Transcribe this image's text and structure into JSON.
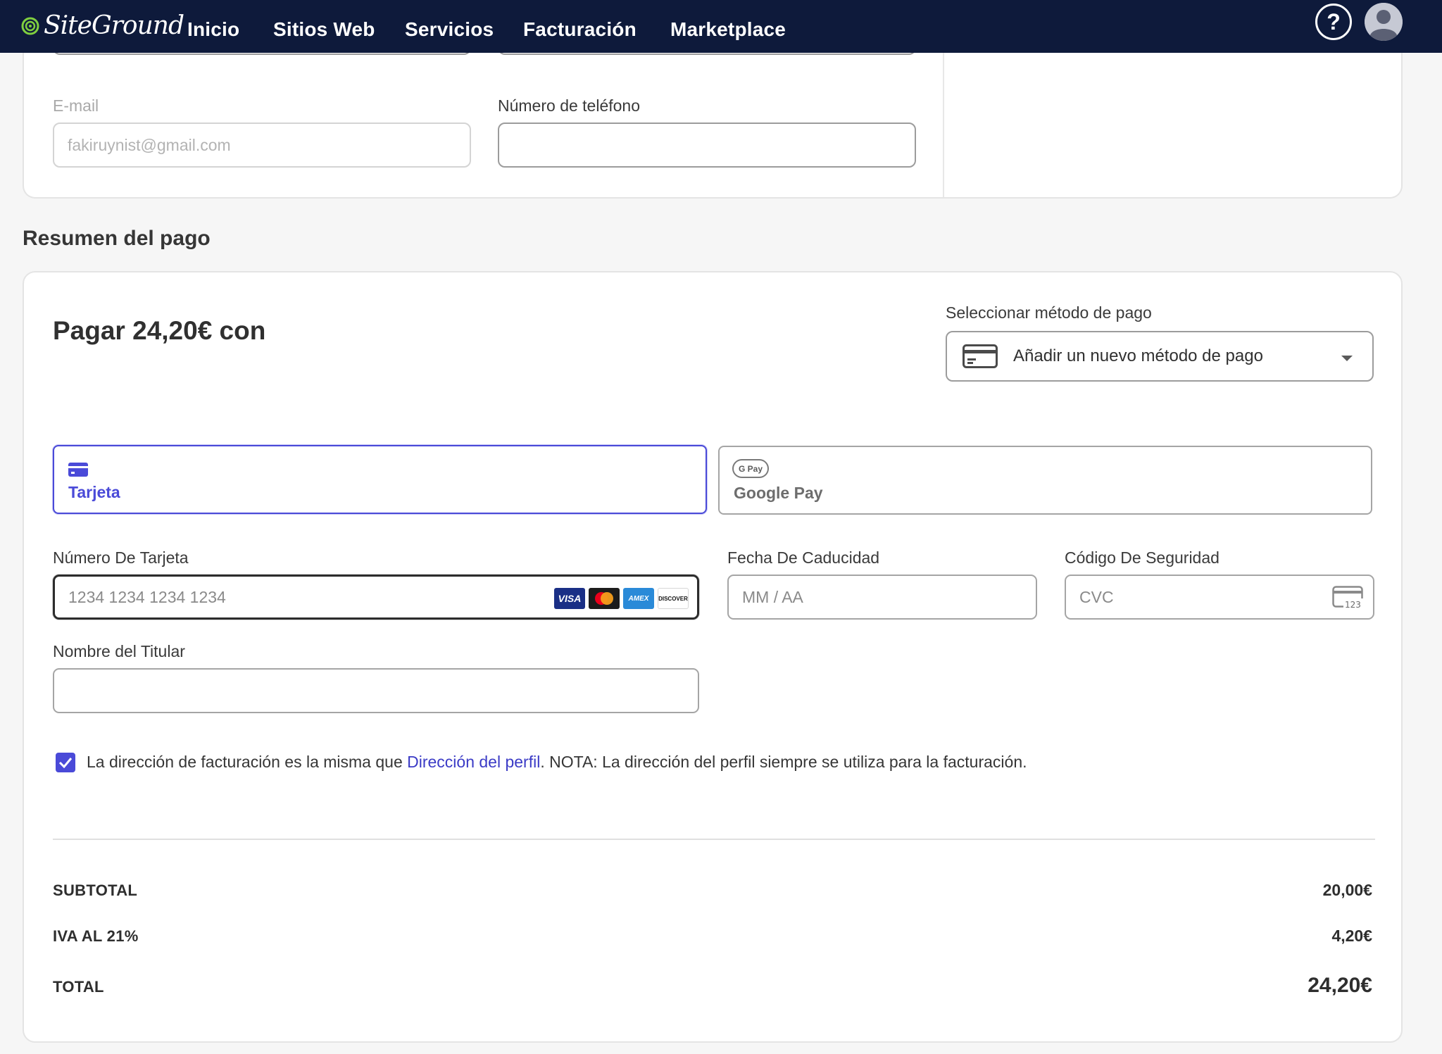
{
  "nav": {
    "logo": "SiteGround",
    "items": [
      "Inicio",
      "Sitios Web",
      "Servicios",
      "Facturación",
      "Marketplace"
    ],
    "help": "?"
  },
  "contact": {
    "email_label": "E-mail",
    "email_value": "fakiruynist@gmail.com",
    "phone_label": "Número de teléfono",
    "phone_value": ""
  },
  "payment": {
    "section_title": "Resumen del pago",
    "heading": "Pagar 24,20€ con",
    "method_label": "Seleccionar método de pago",
    "method_selected": "Añadir un nuevo método de pago",
    "tabs": [
      {
        "label": "Tarjeta",
        "icon": "credit-card-icon",
        "active": true
      },
      {
        "label": "Google Pay",
        "icon": "google-pay-icon",
        "badge": "G Pay",
        "active": false
      }
    ],
    "card_number_label": "Número De Tarjeta",
    "card_number_placeholder": "1234 1234 1234 1234",
    "card_brands": [
      "VISA",
      "Mastercard",
      "AMEX",
      "DISCOVER"
    ],
    "expiry_label": "Fecha De Caducidad",
    "expiry_placeholder": "MM / AA",
    "cvc_label": "Código De Seguridad",
    "cvc_placeholder": "CVC",
    "cvc_icon_text": "123",
    "holder_label": "Nombre del Titular",
    "holder_value": "",
    "billing_checked": true,
    "billing_text_before": "La dirección de facturación es la misma que ",
    "billing_link": "Dirección del perfil",
    "billing_text_after": ". NOTA: La dirección del perfil siempre se utiliza para la facturación."
  },
  "summary": {
    "subtotal_label": "SUBTOTAL",
    "subtotal_value": "20,00€",
    "tax_label": "IVA AL 21%",
    "tax_value": "4,20€",
    "total_label": "TOTAL",
    "total_value": "24,20€"
  },
  "colors": {
    "nav_bg": "#0e1a3b",
    "accent": "#4a4ad8",
    "link": "#3b3bc6",
    "logo_green": "#7fcf3f"
  }
}
